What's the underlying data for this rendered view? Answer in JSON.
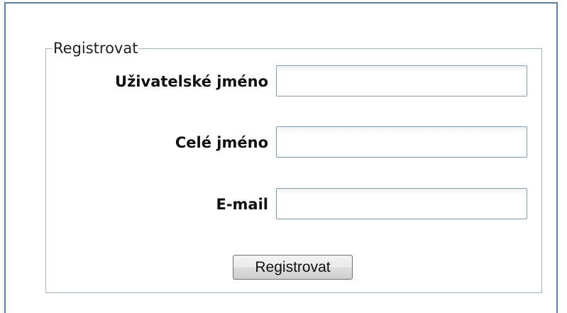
{
  "form": {
    "legend": "Registrovat",
    "fields": [
      {
        "label": "Uživatelské jméno",
        "value": "",
        "placeholder": ""
      },
      {
        "label": "Celé jméno",
        "value": "",
        "placeholder": ""
      },
      {
        "label": "E-mail",
        "value": "",
        "placeholder": ""
      }
    ],
    "submit_label": "Registrovat"
  },
  "colors": {
    "frame_border": "#5a7fb5",
    "fieldset_border": "#a3b9c9",
    "input_border": "#7f9db9"
  }
}
